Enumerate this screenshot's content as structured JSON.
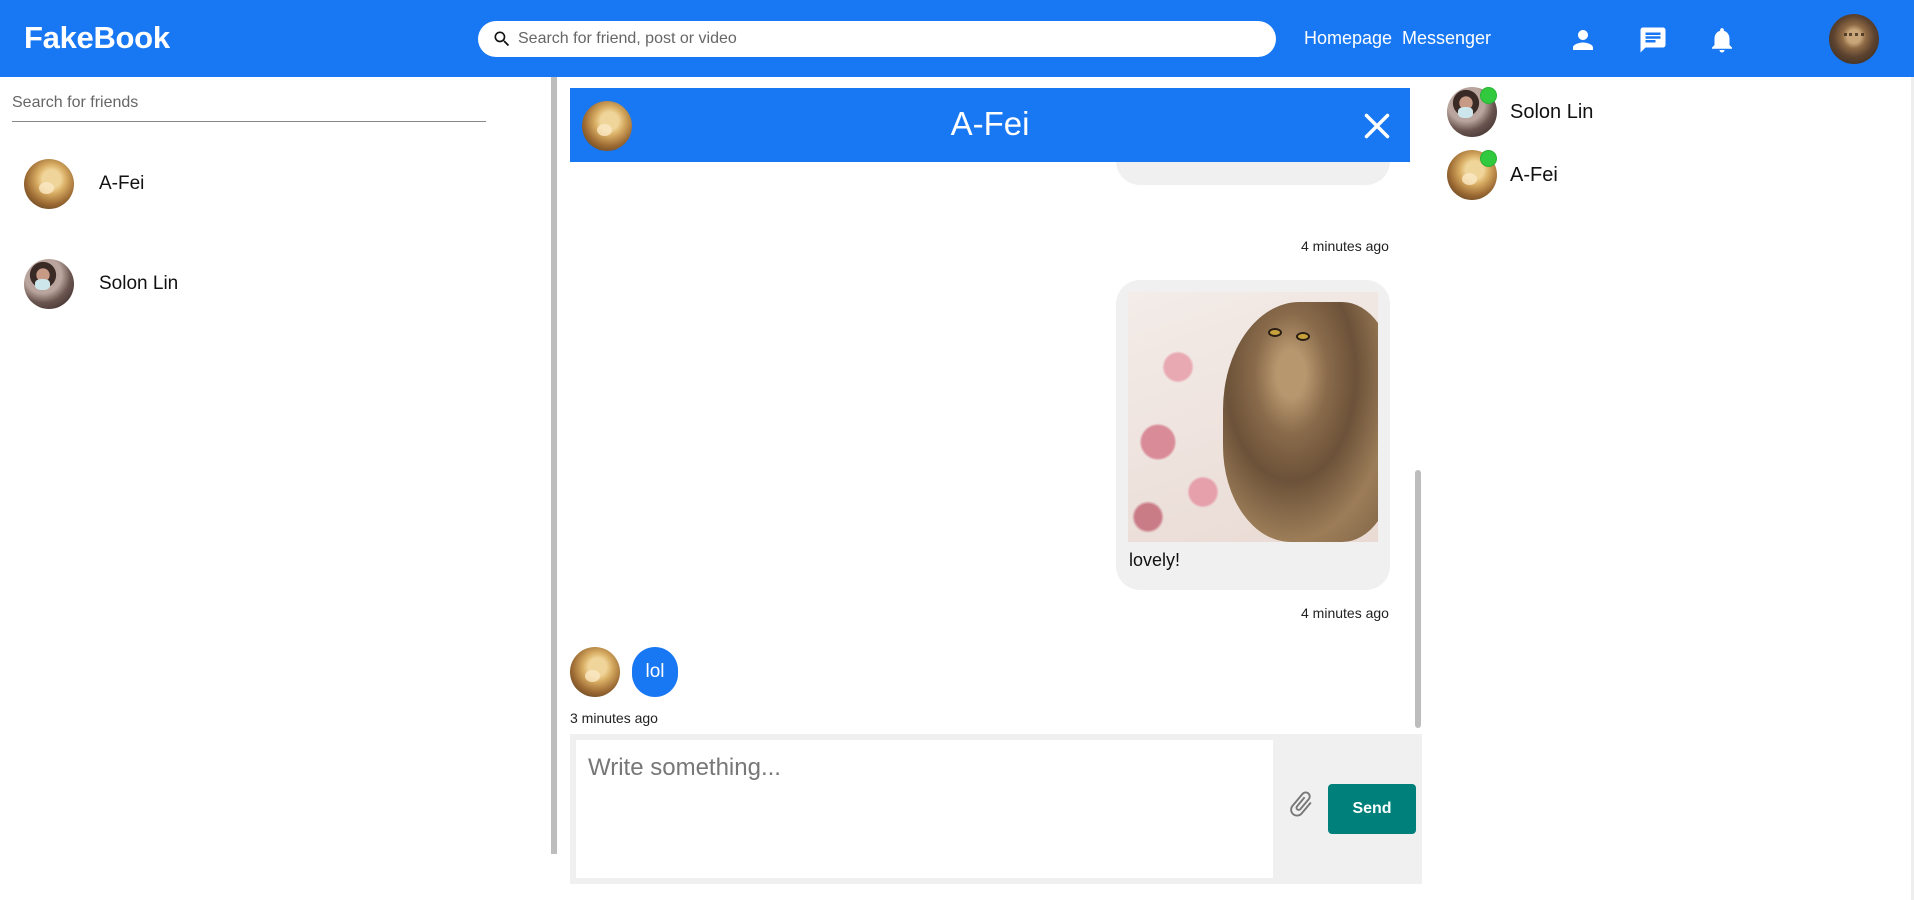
{
  "header": {
    "brand": "FakeBook",
    "search_placeholder": "Search for friend, post or video",
    "nav": {
      "homepage": "Homepage",
      "messenger": "Messenger"
    },
    "icons": [
      "person-icon",
      "chat-icon",
      "bell-icon"
    ],
    "brand_color": "#1877f2"
  },
  "left": {
    "search_placeholder": "Search for friends",
    "friends": [
      {
        "name": "A-Fei"
      },
      {
        "name": "Solon Lin"
      }
    ]
  },
  "chat": {
    "title": "A-Fei",
    "messages": [
      {
        "from": "me",
        "type": "image",
        "caption": "",
        "time": "4 minutes ago"
      },
      {
        "from": "me",
        "type": "image",
        "caption": "lovely!",
        "time": "4 minutes ago"
      },
      {
        "from": "A-Fei",
        "type": "text",
        "text": "lol",
        "time": "3 minutes ago"
      }
    ],
    "composer": {
      "placeholder": "Write something...",
      "send_label": "Send",
      "send_color": "#00807a"
    }
  },
  "online": {
    "status_color": "#31c93d",
    "friends": [
      {
        "name": "Solon Lin"
      },
      {
        "name": "A-Fei"
      }
    ]
  }
}
